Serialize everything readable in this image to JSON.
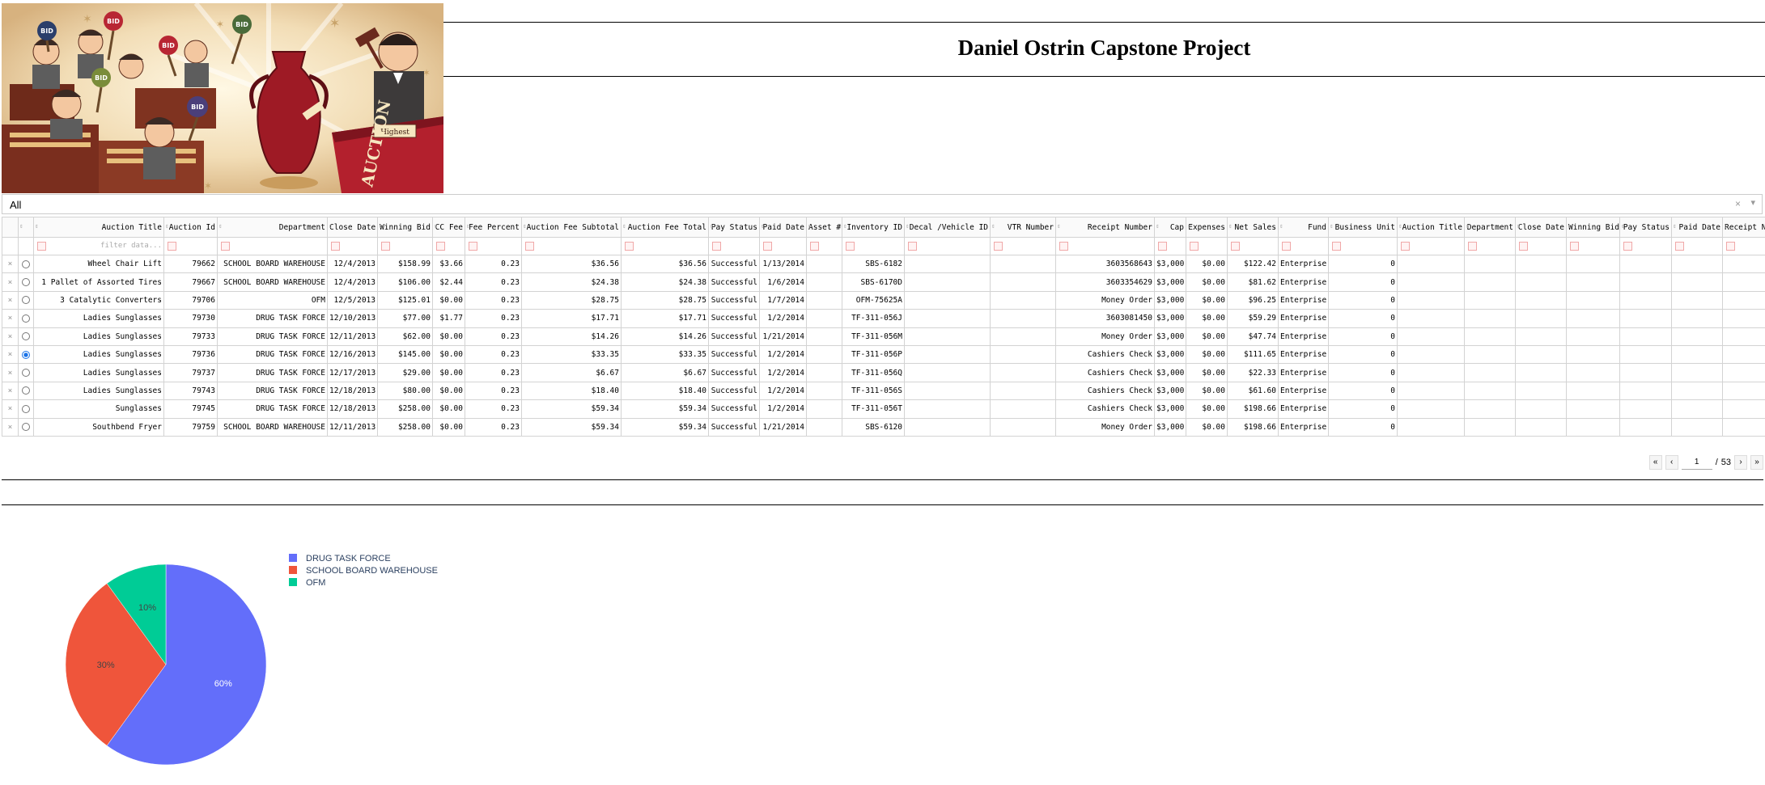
{
  "header": {
    "title": "Daniel Ostrin Capstone Project"
  },
  "banner": {
    "signs": [
      "BID",
      "BID",
      "BID",
      "BID",
      "BID",
      "BID"
    ],
    "podium_text": "AUCTION",
    "bid_card_text": "Highest"
  },
  "filter": {
    "value": "All",
    "clear_icon": "×",
    "arrow_icon": "▾"
  },
  "table": {
    "columns": [
      "Auction Title",
      "Auction Id",
      "Department",
      "Close Date",
      "Winning Bid",
      "CC Fee",
      "Fee Percent",
      "Auction Fee Subtotal",
      "Auction Fee Total",
      "Pay Status",
      "Paid Date",
      "Asset #",
      "Inventory ID",
      "Decal /Vehicle ID",
      "VTR Number",
      "Receipt Number",
      "Cap",
      "Expenses",
      "Net Sales",
      "Fund",
      "Business Unit",
      "Auction Title",
      "Department",
      "Close Date",
      "Winning Bid",
      "Pay Status",
      "Paid Date",
      "Receipt Numbe"
    ],
    "filter_placeholder": "filter data...",
    "delete_icon": "×",
    "sort_icon": "⇕",
    "rows": [
      [
        "Wheel Chair Lift",
        "79662",
        "SCHOOL BOARD WAREHOUSE",
        "12/4/2013",
        "$158.99",
        "$3.66",
        "0.23",
        "$36.56",
        "$36.56",
        "Successful",
        "1/13/2014",
        "",
        "SBS-6182",
        "",
        "",
        "3603568643",
        "$3,000",
        "$0.00",
        "$122.42",
        "Enterprise",
        "0",
        "",
        "",
        "",
        "",
        "",
        "",
        ""
      ],
      [
        "1 Pallet of Assorted Tires",
        "79667",
        "SCHOOL BOARD WAREHOUSE",
        "12/4/2013",
        "$106.00",
        "$2.44",
        "0.23",
        "$24.38",
        "$24.38",
        "Successful",
        "1/6/2014",
        "",
        "SBS-6170D",
        "",
        "",
        "3603354629",
        "$3,000",
        "$0.00",
        "$81.62",
        "Enterprise",
        "0",
        "",
        "",
        "",
        "",
        "",
        "",
        ""
      ],
      [
        "3 Catalytic Converters",
        "79706",
        "OFM",
        "12/5/2013",
        "$125.01",
        "$0.00",
        "0.23",
        "$28.75",
        "$28.75",
        "Successful",
        "1/7/2014",
        "",
        "OFM-75625A",
        "",
        "",
        "Money Order",
        "$3,000",
        "$0.00",
        "$96.25",
        "Enterprise",
        "0",
        "",
        "",
        "",
        "",
        "",
        "",
        ""
      ],
      [
        "Ladies Sunglasses",
        "79730",
        "DRUG TASK FORCE",
        "12/10/2013",
        "$77.00",
        "$1.77",
        "0.23",
        "$17.71",
        "$17.71",
        "Successful",
        "1/2/2014",
        "",
        "TF-311-056J",
        "",
        "",
        "3603081450",
        "$3,000",
        "$0.00",
        "$59.29",
        "Enterprise",
        "0",
        "",
        "",
        "",
        "",
        "",
        "",
        ""
      ],
      [
        "Ladies Sunglasses",
        "79733",
        "DRUG TASK FORCE",
        "12/11/2013",
        "$62.00",
        "$0.00",
        "0.23",
        "$14.26",
        "$14.26",
        "Successful",
        "1/21/2014",
        "",
        "TF-311-056M",
        "",
        "",
        "Money Order",
        "$3,000",
        "$0.00",
        "$47.74",
        "Enterprise",
        "0",
        "",
        "",
        "",
        "",
        "",
        "",
        ""
      ],
      [
        "Ladies Sunglasses",
        "79736",
        "DRUG TASK FORCE",
        "12/16/2013",
        "$145.00",
        "$0.00",
        "0.23",
        "$33.35",
        "$33.35",
        "Successful",
        "1/2/2014",
        "",
        "TF-311-056P",
        "",
        "",
        "Cashiers Check",
        "$3,000",
        "$0.00",
        "$111.65",
        "Enterprise",
        "0",
        "",
        "",
        "",
        "",
        "",
        "",
        ""
      ],
      [
        "Ladies Sunglasses",
        "79737",
        "DRUG TASK FORCE",
        "12/17/2013",
        "$29.00",
        "$0.00",
        "0.23",
        "$6.67",
        "$6.67",
        "Successful",
        "1/2/2014",
        "",
        "TF-311-056Q",
        "",
        "",
        "Cashiers Check",
        "$3,000",
        "$0.00",
        "$22.33",
        "Enterprise",
        "0",
        "",
        "",
        "",
        "",
        "",
        "",
        ""
      ],
      [
        "Ladies Sunglasses",
        "79743",
        "DRUG TASK FORCE",
        "12/18/2013",
        "$80.00",
        "$0.00",
        "0.23",
        "$18.40",
        "$18.40",
        "Successful",
        "1/2/2014",
        "",
        "TF-311-056S",
        "",
        "",
        "Cashiers Check",
        "$3,000",
        "$0.00",
        "$61.60",
        "Enterprise",
        "0",
        "",
        "",
        "",
        "",
        "",
        "",
        ""
      ],
      [
        "Sunglasses",
        "79745",
        "DRUG TASK FORCE",
        "12/18/2013",
        "$258.00",
        "$0.00",
        "0.23",
        "$59.34",
        "$59.34",
        "Successful",
        "1/2/2014",
        "",
        "TF-311-056T",
        "",
        "",
        "Cashiers Check",
        "$3,000",
        "$0.00",
        "$198.66",
        "Enterprise",
        "0",
        "",
        "",
        "",
        "",
        "",
        "",
        ""
      ],
      [
        "Southbend Fryer",
        "79759",
        "SCHOOL BOARD WAREHOUSE",
        "12/11/2013",
        "$258.00",
        "$0.00",
        "0.23",
        "$59.34",
        "$59.34",
        "Successful",
        "1/21/2014",
        "",
        "SBS-6120",
        "",
        "",
        "Money Order",
        "$3,000",
        "$0.00",
        "$198.66",
        "Enterprise",
        "0",
        "",
        "",
        "",
        "",
        "",
        "",
        ""
      ]
    ],
    "selected_row": 5
  },
  "pager": {
    "first": "«",
    "prev": "‹",
    "page": "1",
    "sep": "/",
    "total": "53",
    "next": "›",
    "last": "»"
  },
  "chart_data": {
    "type": "pie",
    "categories": [
      "DRUG TASK FORCE",
      "SCHOOL BOARD WAREHOUSE",
      "OFM"
    ],
    "values": [
      60,
      30,
      10
    ],
    "labels": [
      "60%",
      "30%",
      "10%"
    ],
    "colors": [
      "#636efa",
      "#ef553b",
      "#00cc96"
    ],
    "legend_position": "right"
  }
}
